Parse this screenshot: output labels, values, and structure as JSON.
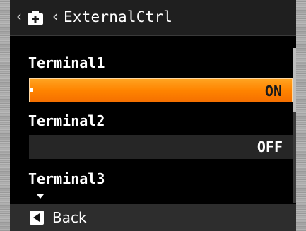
{
  "header": {
    "title": "ExternalCtrl",
    "left_chevron": "‹",
    "section_chevron": "‹",
    "icon": "camera-icon"
  },
  "items": [
    {
      "label": "Terminal1",
      "value": "ON",
      "selected": true
    },
    {
      "label": "Terminal2",
      "value": "OFF",
      "selected": false
    },
    {
      "label": "Terminal3"
    }
  ],
  "footer": {
    "back_label": "Back",
    "back_icon": "back-arrow-icon"
  },
  "colors": {
    "highlight": "#ff8a00",
    "background": "#000000",
    "row_background": "#262626"
  }
}
